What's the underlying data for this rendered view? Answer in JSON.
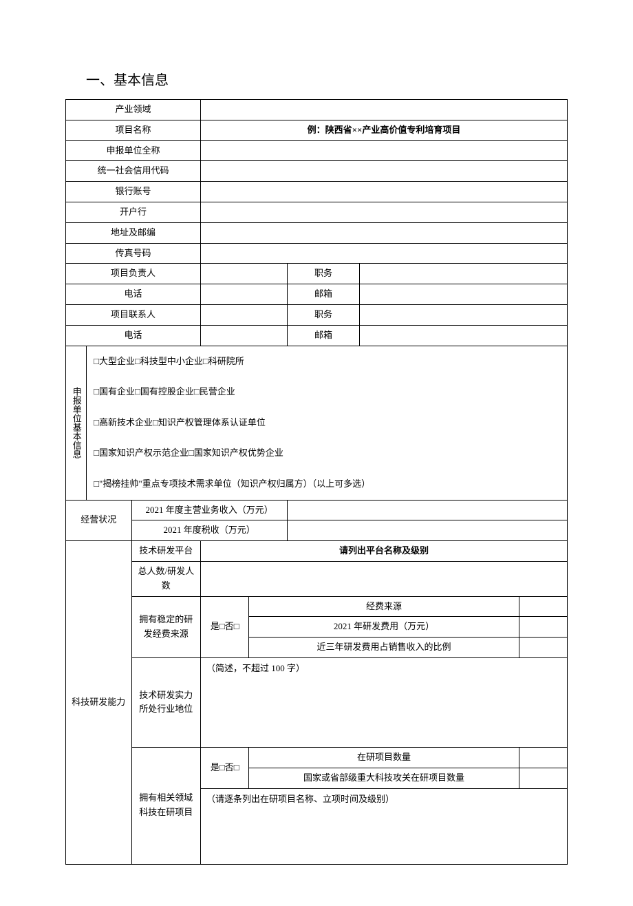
{
  "sectionTitle": "一、基本信息",
  "rows": {
    "industryField": "产业领域",
    "projectName": "项目名称",
    "projectNameExample": "例：陕西省××产业高价值专利培育项目",
    "applicantFullName": "申报单位全称",
    "socialCreditCode": "统一社会信用代码",
    "bankAccount": "银行账号",
    "bankName": "开户行",
    "addressPostcode": "地址及邮编",
    "faxNumber": "传真号码",
    "projectLeader": "项目负责人",
    "position": "职务",
    "phone": "电话",
    "email": "邮箱",
    "projectContact": "项目联系人"
  },
  "applicantInfo": {
    "sideLabel": "申报单位基本信息",
    "checkboxes": {
      "line1": "□大型企业□科技型中小企业□科研院所",
      "line2": "□国有企业□国有控股企业□民营企业",
      "line3": "□高新技术企业□知识产权管理体系认证单位",
      "line4": "□国家知识产权示范企业□国家知识产权优势企业",
      "line5": "□\"揭榜挂帅\"重点专项技术需求单位（知识产权归属方）（以上可多选）"
    }
  },
  "operations": {
    "sideLabel": "经营状况",
    "revenue2021": "2021 年度主营业务收入（万元）",
    "tax2021": "2021 年度税收（万元）"
  },
  "rd": {
    "sideLabel": "科技研发能力",
    "platform": "技术研发平台",
    "platformHint": "请列出平台名称及级别",
    "headcount": "总人数/研发人数",
    "stableFunding": "拥有稳定的研发经费来源",
    "yesNo": "是□否□",
    "fundingSource": "经费来源",
    "rdExpense2021": "2021 年研发费用（万元）",
    "rdRatio": "近三年研发费用占销售收入的比例",
    "industryPosition": "技术研发实力所处行业地位",
    "positionHint": "（简述，不超过 100 字）",
    "ongoingProjects": "拥有相关领域科技在研项目",
    "ongoingCount": "在研项目数量",
    "majorProjectCount": "国家或省部级重大科技攻关在研项目数量",
    "projectListHint": "（请逐条列出在研项目名称、立项时间及级别）"
  }
}
